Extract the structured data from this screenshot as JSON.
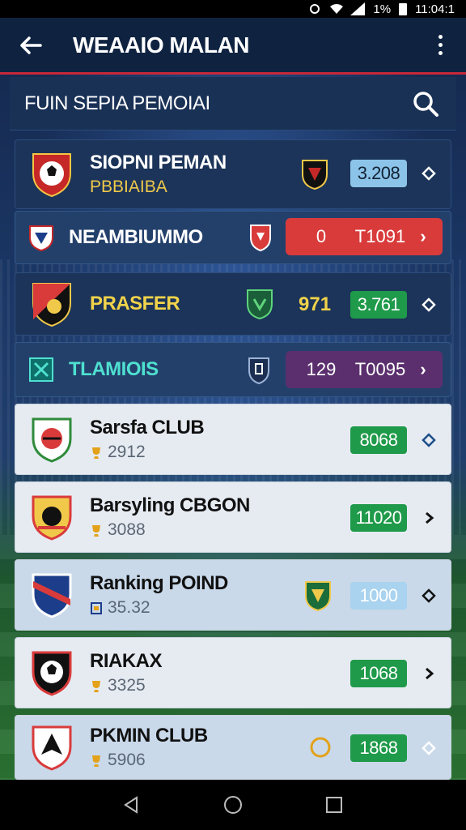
{
  "status_bar": {
    "battery": "1%",
    "time": "11:04:1"
  },
  "app_bar": {
    "title": "WEAAIO MALAN"
  },
  "section": {
    "title": "FUIN SEPIA PEMOIAI"
  },
  "rows": [
    {
      "name": "SIOPNI PEMAN",
      "sub": "PBBIAIBA",
      "value": "3.208"
    },
    {
      "name": "NEAMBIUMMO",
      "left_num": "0",
      "right_num": "T1091"
    },
    {
      "name": "PRASFER",
      "num": "971",
      "value": "3.761"
    },
    {
      "name": "TLAMIOIS",
      "left_num": "129",
      "right_num": "T0095"
    },
    {
      "name": "Sarsfa CLUB",
      "sub": "2912",
      "value": "8068"
    },
    {
      "name": "Barsyling CBGON",
      "sub": "3088",
      "value": "11020"
    },
    {
      "name": "Ranking POIND",
      "sub": "35.32",
      "value": "1000"
    },
    {
      "name": "RIAKAX",
      "sub": "3325",
      "value": "1068"
    },
    {
      "name": "PKMIN CLUB",
      "sub": "5906",
      "value": "1868"
    }
  ],
  "colors": {
    "accent_red": "#d93b3b",
    "accent_green": "#1f9a4a",
    "accent_purple": "#5b2f6e",
    "header_bg": "#0f2341"
  }
}
